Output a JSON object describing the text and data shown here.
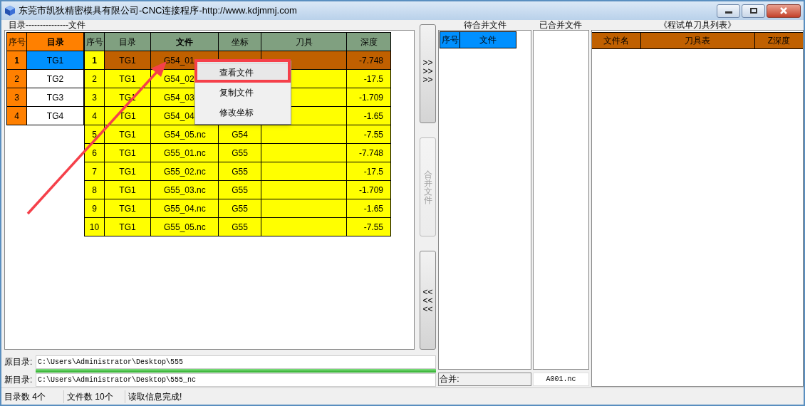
{
  "window": {
    "title": "东莞市凯狄精密模具有限公司-CNC连接程序-http://www.kdjmmj.com"
  },
  "group_label": "目录---------------文件",
  "directory_table": {
    "columns": [
      "序号",
      "目录"
    ],
    "rows": [
      {
        "index": "1",
        "name": "TG1",
        "selected": true
      },
      {
        "index": "2",
        "name": "TG2",
        "selected": false
      },
      {
        "index": "3",
        "name": "TG3",
        "selected": false
      },
      {
        "index": "4",
        "name": "TG4",
        "selected": false
      }
    ]
  },
  "file_table": {
    "columns": [
      "序号",
      "目录",
      "文件",
      "坐标",
      "刀具",
      "深度"
    ],
    "rows": [
      {
        "index": "1",
        "directory": "TG1",
        "file": "G54_01",
        "depth": "-7.748",
        "selected": true
      },
      {
        "index": "2",
        "directory": "TG1",
        "file": "G54_02",
        "depth": "-17.5",
        "selected": false
      },
      {
        "index": "3",
        "directory": "TG1",
        "file": "G54_03",
        "depth": "-1.709",
        "selected": false
      },
      {
        "index": "4",
        "directory": "TG1",
        "file": "G54_04",
        "depth": "-1.65",
        "selected": false
      },
      {
        "index": "5",
        "directory": "TG1",
        "file": "G54_05.nc",
        "coordinate": "G54",
        "depth": "-7.55",
        "selected": false
      },
      {
        "index": "6",
        "directory": "TG1",
        "file": "G55_01.nc",
        "coordinate": "G55",
        "depth": "-7.748",
        "selected": false
      },
      {
        "index": "7",
        "directory": "TG1",
        "file": "G55_02.nc",
        "coordinate": "G55",
        "depth": "-17.5",
        "selected": false
      },
      {
        "index": "8",
        "directory": "TG1",
        "file": "G55_03.nc",
        "coordinate": "G55",
        "depth": "-1.709",
        "selected": false
      },
      {
        "index": "9",
        "directory": "TG1",
        "file": "G55_04.nc",
        "coordinate": "G55",
        "depth": "-1.65",
        "selected": false
      },
      {
        "index": "10",
        "directory": "TG1",
        "file": "G55_05.nc",
        "coordinate": "G55",
        "depth": "-7.55",
        "selected": false
      }
    ]
  },
  "context_menu": [
    {
      "label": "查看文件",
      "selected": true
    },
    {
      "label": "复制文件",
      "selected": false
    },
    {
      "label": "修改坐标",
      "selected": false
    }
  ],
  "side_buttons": [
    {
      "lines": [
        ">>",
        ">>",
        ">>"
      ],
      "disabled": false
    },
    {
      "lines": [
        "合",
        "并",
        "文",
        "件"
      ],
      "disabled": true
    },
    {
      "lines": [
        "<<",
        "<<",
        "<<"
      ],
      "disabled": false
    }
  ],
  "pending": {
    "title": "待合并文件",
    "columns": [
      "序号",
      "文件"
    ],
    "field_label": "合并:"
  },
  "merged": {
    "title": "已合并文件",
    "value": "A001.nc"
  },
  "tool_list": {
    "title": "《程试单刀具列表》",
    "columns": [
      "文件名",
      "刀具表",
      "Z深度"
    ]
  },
  "source_dir": {
    "label": "原目录:",
    "value": "C:\\Users\\Administrator\\Desktop\\555"
  },
  "progress": {
    "level": 1
  },
  "target_dir": {
    "label": "新目录:",
    "value": "C:\\Users\\Administrator\\Desktop\\555_nc"
  },
  "status_bar": [
    "目录数 4个",
    "文件数 10个",
    "读取信息完成!"
  ]
}
